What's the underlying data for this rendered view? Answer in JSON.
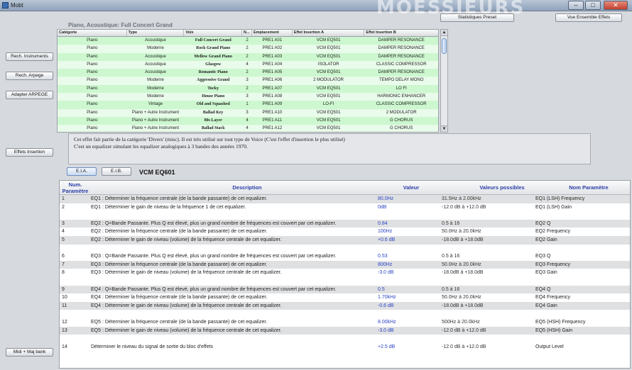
{
  "window": {
    "title": "Mobt",
    "banner": "MOESSIEURS",
    "minimize": "–",
    "maximize": "□",
    "close": "✕"
  },
  "top_buttons": {
    "stats": "Statistiques Preset",
    "overview": "Vue Ensemble Effets"
  },
  "left_buttons": {
    "search_instruments": "Rech. Instruments",
    "search_arpeggio": "Rech. Arpege",
    "adapt_arpeggio": "Adapter ARPEGE",
    "insertion_effects": "Effets Insertion",
    "midi_update": "Midi + Maj bank"
  },
  "preset_title": "Piano, Acoustique:  Full Concert Grand",
  "voice_table": {
    "headers": [
      "Catégorie",
      "Type",
      "Voix",
      "N...",
      "Emplacement",
      "Effet Insertion A",
      "Effet Insertion B"
    ],
    "rows": [
      [
        "Piano",
        "Acoustique",
        "Full Concert Grand",
        "2",
        "PRE1 A01",
        "VCM EQ501",
        "DAMPER RESONANCE"
      ],
      [
        "Piano",
        "Moderne",
        "Rock Grand Piano",
        "2",
        "PRE1 A02",
        "VCM EQ501",
        "DAMPER RESONANCE"
      ],
      [
        "Piano",
        "Acoustique",
        "Mellow Grand Piano",
        "2",
        "PRE1 A03",
        "VCM EQ501",
        "DAMPER RESONANCE"
      ],
      [
        "Piano",
        "Acoustique",
        "Glasgow",
        "4",
        "PRE1 A04",
        "ISOLATOR",
        "CLASSIC COMPRESSOR"
      ],
      [
        "Piano",
        "Acoustique",
        "Romantic Piano",
        "2",
        "PRE1 A05",
        "VCM EQ501",
        "DAMPER RESONANCE"
      ],
      [
        "Piano",
        "Moderne",
        "Aggressive Grand",
        "3",
        "PRE1 A06",
        "2 MODULATOR",
        "TEMPO DELAY MONO"
      ],
      [
        "Piano",
        "Moderne",
        "Tucky",
        "2",
        "PRE1 A07",
        "VCM EQ501",
        "LO FI"
      ],
      [
        "Piano",
        "Moderne",
        "House Piano",
        "3",
        "PRE1 A08",
        "VCM EQ501",
        "HARMONIC ENHANCER"
      ],
      [
        "Piano",
        "Vintage",
        "Old and Squashed",
        "1",
        "PRE1 A09",
        "LO-FI",
        "CLASSIC COMPRESSOR"
      ],
      [
        "Piano",
        "Piano + Autre Instrument",
        "Ballad Key",
        "3",
        "PRE1 A10",
        "VCM EQ501",
        "2 MODULATOR"
      ],
      [
        "Piano",
        "Piano + Autre Instrument",
        "80s Layer",
        "4",
        "PRE1 A11",
        "VCM EQ501",
        "G CHORUS"
      ],
      [
        "Piano",
        "Piano + Autre Instrument",
        "Ballad Stack",
        "4",
        "PRE1 A12",
        "VCM EQ501",
        "G CHORUS"
      ]
    ]
  },
  "description": {
    "line1": "Cet effet fait partie de la catégorie 'Divers' (misc). Il est très utilisé sur tout type de Voice (C'est l'effet d'insertion le plus utilisé)",
    "line2": "C'est un equalizer simulant les equalizer analogiques à 3 bandes des années 1970."
  },
  "effect_tabs": {
    "a": "E.I.A.",
    "b": "E.I.B."
  },
  "effect_name": "VCM EQ601",
  "param_table": {
    "headers": {
      "num": "Num. Paramètre",
      "desc": "Description",
      "value": "Valeur",
      "range": "Valeurs possibles",
      "name": "Nom Paramètre"
    },
    "rows": [
      {
        "num": "1",
        "desc": "EQ1 : Déterminer la fréquence centrale (de la bande passante) de cet equalizer.",
        "value": "80.0Hz",
        "range": "31.5Hz à 2.00kHz",
        "name": "EQ1 (LSH) Frequency",
        "shade": true
      },
      {
        "num": "2",
        "desc": "EQ1 : Déterminer le gain de niveau de la fréquence 1 de cet equalizer.",
        "value": "0dB",
        "range": "-12.0 dB à +12.0 dB",
        "name": "EQ1 (LSH) Gain",
        "shade": false
      },
      {
        "num": "",
        "desc": "",
        "value": "",
        "range": "",
        "name": "",
        "shade": false
      },
      {
        "num": "3",
        "desc": "EQ2 : Q=Bande Passante. Plus Q est élevé, plus un grand nombre de fréquences est couvert par cet equalizer.",
        "value": "0.84",
        "range": "0.5 à 16",
        "name": "EQ2 Q",
        "shade": true
      },
      {
        "num": "4",
        "desc": "EQ2 : Déterminer la fréquence centrale (de la bande passante) de cet equalizer.",
        "value": "100Hz",
        "range": "50.0Hz à 20.0kHz",
        "name": "EQ2 Frequency",
        "shade": false
      },
      {
        "num": "5",
        "desc": "EQ2 : Déterminer le gain de niveau (volume) de la fréquence centrale de cet equalizer.",
        "value": "+0.6 dB",
        "range": "-18.0dB à +18.0dB",
        "name": "EQ2 Gain",
        "shade": true
      },
      {
        "num": "",
        "desc": "",
        "value": "",
        "range": "",
        "name": "",
        "shade": false
      },
      {
        "num": "6",
        "desc": "EQ3 : Q=Bande Passante. Plus Q est élevé, plus un grand nombre de fréquences est couvert par cet equalizer.",
        "value": "0.53",
        "range": "0.5 à 16",
        "name": "EQ3 Q",
        "shade": false
      },
      {
        "num": "7",
        "desc": "EQ3 : Déterminer la fréquence centrale (de la bande passante) de cet equalizer.",
        "value": "800Hz",
        "range": "50.0Hz à 20.0kHz",
        "name": "EQ3 Frequency",
        "shade": true
      },
      {
        "num": "8",
        "desc": "EQ3 : Déterminer le gain de niveau (volume) de la fréquence centrale de cet equalizer.",
        "value": "-3.0 dB",
        "range": "-18.0dB à +18.0dB",
        "name": "EQ3 Gain",
        "shade": false
      },
      {
        "num": "",
        "desc": "",
        "value": "",
        "range": "",
        "name": "",
        "shade": false
      },
      {
        "num": "9",
        "desc": "EQ4 : Q=Bande Passante. Plus Q est élevé, plus un grand nombre de fréquences est couvert par cet equalizer.",
        "value": "0.5",
        "range": "0.5 à 16",
        "name": "EQ4 Q",
        "shade": true
      },
      {
        "num": "10",
        "desc": "EQ4 : Déterminer la fréquence centrale (de la bande passante) de cet equalizer.",
        "value": "1.70kHz",
        "range": "50.0Hz à 20.0kHz",
        "name": "EQ4 Frequency",
        "shade": false
      },
      {
        "num": "11",
        "desc": "EQ4 : Déterminer le gain de niveau (volume) de la fréquence centrale de cet equalizer.",
        "value": "-0.6 dB",
        "range": "-18.0dB à +18.0dB",
        "name": "EQ4 Gain",
        "shade": true
      },
      {
        "num": "",
        "desc": "",
        "value": "",
        "range": "",
        "name": "",
        "shade": false
      },
      {
        "num": "12",
        "desc": "EQ5 : Déterminer la fréquence centrale (de la bande passante) de cet equalizer.",
        "value": "8.00kHz",
        "range": "500Hz à 20.0kHz",
        "name": "EQ5 (HSH) Frequency",
        "shade": false
      },
      {
        "num": "13",
        "desc": "EQ5 : Déterminer le gain de niveau (volume) de la fréquence centrale de cet equalizer.",
        "value": "-3.0 dB",
        "range": "-12.0 dB à +12.0 dB",
        "name": "EQ5 (HSH) Gain",
        "shade": true
      },
      {
        "num": "",
        "desc": "",
        "value": "",
        "range": "",
        "name": "",
        "shade": false
      },
      {
        "num": "14",
        "desc": "Déterminer le niveau du signal de sortie du bloc d'effets",
        "value": "+2.5 dB",
        "range": "-12.0 dB à +12.0 dB",
        "name": "Output Level",
        "shade": false
      }
    ]
  }
}
